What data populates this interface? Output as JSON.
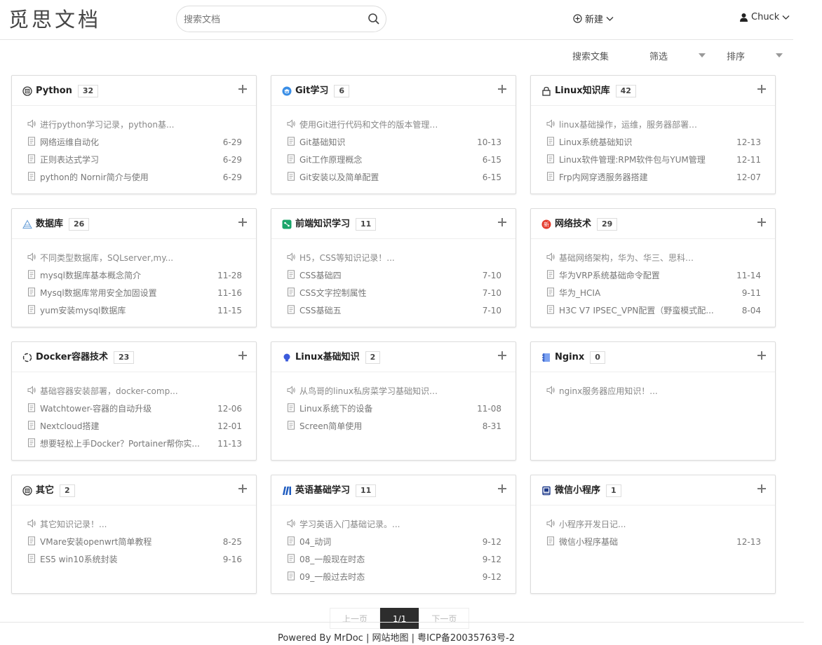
{
  "header": {
    "logo": "觅思文档",
    "search_placeholder": "搜索文档",
    "new_label": "新建",
    "user_label": "Chuck"
  },
  "toolbar": {
    "search_collection": "搜索文集",
    "filter": "筛选",
    "sort": "排序"
  },
  "cards": [
    {
      "title": "Python",
      "count": "32",
      "icon": "book-icon",
      "desc": "进行python学习记录，python基...",
      "items": [
        {
          "t": "网络运维自动化",
          "d": "6-29"
        },
        {
          "t": "正则表达式学习",
          "d": "6-29"
        },
        {
          "t": "python的 Nornir简介与使用",
          "d": "6-29"
        }
      ]
    },
    {
      "title": "Git学习",
      "count": "6",
      "icon": "git-icon",
      "desc": "使用Git进行代码和文件的版本管理，熟练...",
      "items": [
        {
          "t": "Git基础知识",
          "d": "10-13"
        },
        {
          "t": "Git工作原理概念",
          "d": "6-15"
        },
        {
          "t": "Git安装以及简单配置",
          "d": "6-15"
        }
      ]
    },
    {
      "title": "Linux知识库",
      "count": "42",
      "icon": "lock-icon",
      "desc": "linux基础操作，运维，服务器部署等操...",
      "items": [
        {
          "t": "Linux系统基础知识",
          "d": "12-13"
        },
        {
          "t": "Linux软件管理:RPM软件包与YUM管理",
          "d": "12-11"
        },
        {
          "t": "Frp内网穿透服务器搭建",
          "d": "12-07"
        }
      ]
    },
    {
      "title": "数据库",
      "count": "26",
      "icon": "database-icon",
      "desc": "不同类型数据库，SQLserver,my...",
      "items": [
        {
          "t": "mysql数据库基本概念简介",
          "d": "11-28"
        },
        {
          "t": "Mysql数据库常用安全加固设置",
          "d": "11-16"
        },
        {
          "t": "yum安装mysql数据库",
          "d": "11-15"
        }
      ]
    },
    {
      "title": "前端知识学习",
      "count": "11",
      "icon": "frontend-icon",
      "desc": "H5，CSS等知识记录！...",
      "items": [
        {
          "t": "CSS基础四",
          "d": "7-10"
        },
        {
          "t": "CSS文字控制属性",
          "d": "7-10"
        },
        {
          "t": "CSS基础五",
          "d": "7-10"
        }
      ]
    },
    {
      "title": "网络技术",
      "count": "29",
      "icon": "network-icon",
      "desc": "基础网络架构，华为、华三、思科、锐捷等...",
      "items": [
        {
          "t": "华为VRP系统基础命令配置",
          "d": "11-14"
        },
        {
          "t": "华为_HCIA",
          "d": "9-11"
        },
        {
          "t": "H3C V7 IPSEC_VPN配置（野蛮模式配...",
          "d": "8-04"
        }
      ]
    },
    {
      "title": "Docker容器技术",
      "count": "23",
      "icon": "docker-icon",
      "desc": "基础容器安装部署，docker-comp...",
      "items": [
        {
          "t": "Watchtower-容器的自动升级",
          "d": "12-06"
        },
        {
          "t": "Nextcloud搭建",
          "d": "12-01"
        },
        {
          "t": "想要轻松上手Docker？Portainer帮你实...",
          "d": "11-13"
        }
      ]
    },
    {
      "title": "Linux基础知识",
      "count": "2",
      "icon": "bulb-icon",
      "desc": "从鸟哥的linux私房菜学习基础知识记录...",
      "items": [
        {
          "t": "Linux系统下的设备",
          "d": "11-08"
        },
        {
          "t": "Screen简单使用",
          "d": "8-31"
        }
      ]
    },
    {
      "title": "Nginx",
      "count": "0",
      "icon": "notebook-icon",
      "desc": "nginx服务器应用知识！...",
      "items": []
    },
    {
      "title": "其它",
      "count": "2",
      "icon": "book-icon",
      "desc": "其它知识记录！...",
      "items": [
        {
          "t": "VMare安装openwrt简单教程",
          "d": "8-25"
        },
        {
          "t": "ES5 win10系统封装",
          "d": "9-16"
        }
      ]
    },
    {
      "title": "英语基础学习",
      "count": "11",
      "icon": "library-icon",
      "desc": "学习英语入门基础记录。...",
      "items": [
        {
          "t": "04_动词",
          "d": "9-12"
        },
        {
          "t": "08_一般现在时态",
          "d": "9-12"
        },
        {
          "t": "09_一般过去时态",
          "d": "9-12"
        }
      ]
    },
    {
      "title": "微信小程序",
      "count": "1",
      "icon": "manual-icon",
      "desc": "小程序开发日记...",
      "items": [
        {
          "t": "微信小程序基础",
          "d": "12-13"
        }
      ]
    }
  ],
  "pager": {
    "prev": "上一页",
    "current": "1/1",
    "next": "下一页"
  },
  "footer": {
    "text": "Powered By MrDoc |  网站地图 | 粤ICP备20035763号-2"
  }
}
